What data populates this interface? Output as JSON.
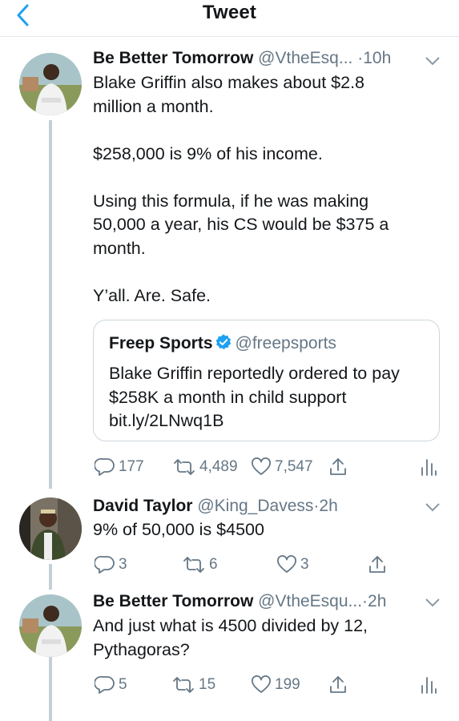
{
  "header": {
    "title": "Tweet"
  },
  "tweets": [
    {
      "author_name": "Be Better Tomorrow",
      "handle": "@VtheEsq...",
      "time": "10h",
      "text": "Blake Griffin also makes about $2.8\nmillion a month.\n\n$258,000 is 9% of his income.\n\nUsing this formula, if he was making\n50,000 a year, his CS would be $375 a\nmonth.\n\nY’all. Are. Safe.",
      "quote": {
        "author_name": "Freep Sports",
        "handle": "@freepsports",
        "text": "Blake Griffin reportedly ordered to\npay $258K a month in child support\nbit.ly/2LNwq1B"
      },
      "replies": "177",
      "retweets": "4,489",
      "likes": "7,547"
    },
    {
      "author_name": "David Taylor",
      "handle": "@King_Davess",
      "time": "2h",
      "text": "9% of 50,000 is $4500",
      "replies": "3",
      "retweets": "6",
      "likes": "3"
    },
    {
      "author_name": "Be Better Tomorrow",
      "handle": "@VtheEsqu...",
      "time": "2h",
      "text": "And just what is 4500 divided by 12,\nPythagoras?",
      "replies": "5",
      "retweets": "15",
      "likes": "199"
    }
  ],
  "colors": {
    "accent": "#1da1f2",
    "muted": "#657786",
    "line": "#c4cfd6"
  },
  "icons": [
    "chevron-left-icon",
    "chevron-down-icon",
    "verified-icon",
    "reply-icon",
    "retweet-icon",
    "like-icon",
    "share-icon",
    "analytics-icon"
  ]
}
